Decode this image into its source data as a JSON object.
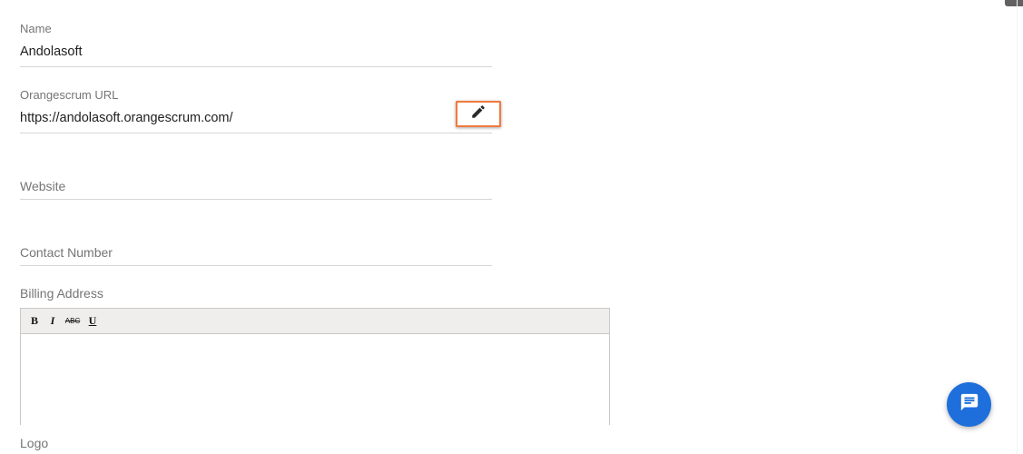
{
  "form": {
    "name": {
      "label": "Name",
      "value": "Andolasoft"
    },
    "url": {
      "label": "Orangescrum URL",
      "value": "https://andolasoft.orangescrum.com/",
      "edit_icon": "pencil-icon"
    },
    "website": {
      "placeholder": "Website"
    },
    "contact": {
      "placeholder": "Contact Number"
    },
    "billing": {
      "label": "Billing Address",
      "toolbar": {
        "bold": "B",
        "italic": "I",
        "strike": "ABC",
        "underline": "U"
      }
    },
    "logo": {
      "label": "Logo"
    }
  },
  "chat": {
    "icon": "chat-message-icon",
    "color": "#1e6fdb"
  },
  "colors": {
    "highlight": "#f07a3e"
  }
}
